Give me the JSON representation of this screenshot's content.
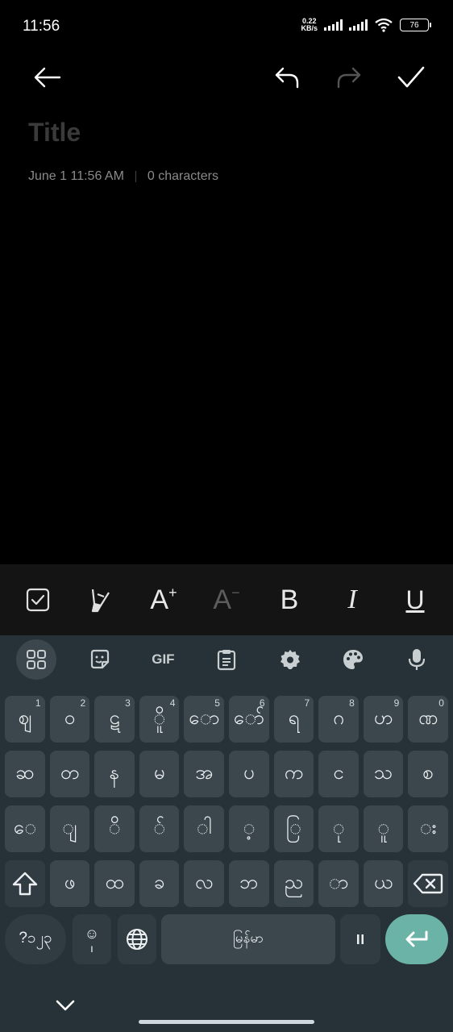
{
  "status_bar": {
    "time": "11:56",
    "net_speed_value": "0.22",
    "net_speed_unit": "KB/s",
    "battery": "76"
  },
  "toolbar": {
    "back": "arrow-left-icon",
    "undo": "undo-icon",
    "redo": "redo-icon",
    "done": "check-icon"
  },
  "note": {
    "title_placeholder": "Title",
    "date": "June 1  11:56 AM",
    "char_count": "0 characters"
  },
  "format_bar": {
    "checklist": "checkbox-icon",
    "highlight": "highlighter-icon",
    "size_up": "A",
    "size_up_sup": "+",
    "size_down": "A",
    "size_down_sup": "−",
    "bold": "B",
    "italic": "I",
    "underline": "U"
  },
  "keyboard": {
    "tools": {
      "gif": "GIF"
    },
    "row1": [
      {
        "char": "ဈ",
        "num": "1"
      },
      {
        "char": "ဝ",
        "num": "2"
      },
      {
        "char": "ဋ",
        "num": "3"
      },
      {
        "char": "ိူ",
        "num": "4"
      },
      {
        "char": "ော",
        "num": "5"
      },
      {
        "char": "ော်",
        "num": "6"
      },
      {
        "char": "ရ",
        "num": "7"
      },
      {
        "char": "ဂ",
        "num": "8"
      },
      {
        "char": "ဟ",
        "num": "9"
      },
      {
        "char": "ဏ",
        "num": "0"
      }
    ],
    "row2": [
      "ဆ",
      "တ",
      "န",
      "မ",
      "အ",
      "ပ",
      "က",
      "င",
      "သ",
      "စ"
    ],
    "row3": [
      "ေ",
      "ျ",
      "ိ",
      "် ",
      "ါ",
      "့",
      "ြ",
      "ု",
      "ူ",
      "း"
    ],
    "row4": [
      "ဖ",
      "ထ",
      "ခ",
      "လ",
      "ဘ",
      "ည",
      "ာ",
      "ယ"
    ],
    "symbols_label": "?၁၂၃",
    "emoji_label": "☺",
    "space_label": "မြန်မာ",
    "accent": "#6bb3a6"
  }
}
